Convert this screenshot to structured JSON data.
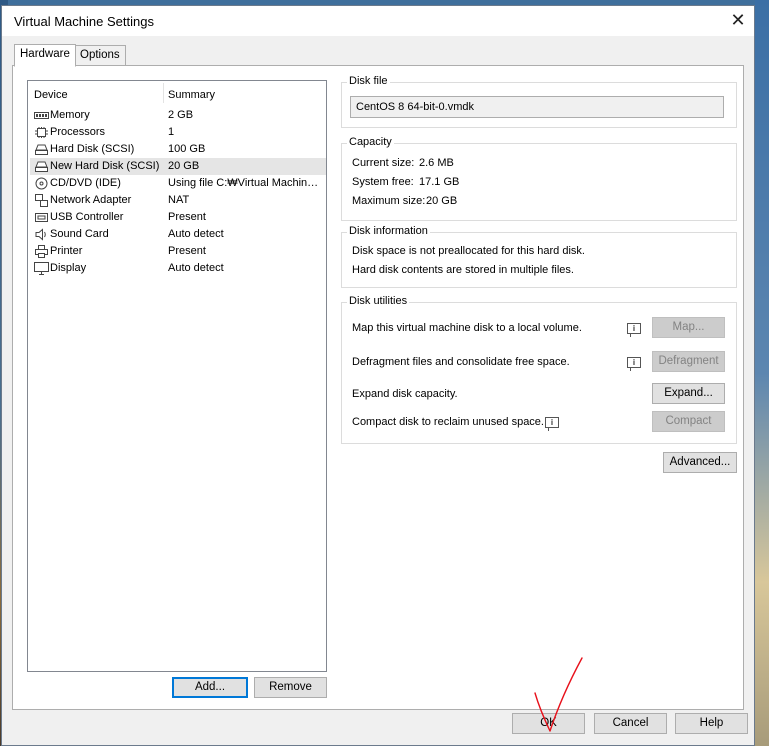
{
  "window": {
    "title": "Virtual Machine Settings"
  },
  "tabs": [
    {
      "label": "Hardware"
    },
    {
      "label": "Options"
    }
  ],
  "devices": {
    "header": {
      "device": "Device",
      "summary": "Summary"
    },
    "items": [
      {
        "name": "Memory",
        "summary": "2 GB",
        "icon": "memory-icon"
      },
      {
        "name": "Processors",
        "summary": "1",
        "icon": "processor-icon"
      },
      {
        "name": "Hard Disk (SCSI)",
        "summary": "100 GB",
        "icon": "hard-disk-icon"
      },
      {
        "name": "New Hard Disk (SCSI)",
        "summary": "20 GB",
        "icon": "hard-disk-icon",
        "selected": true
      },
      {
        "name": "CD/DVD (IDE)",
        "summary": "Using file C:₩Virtual Machin…",
        "icon": "cd-dvd-icon"
      },
      {
        "name": "Network Adapter",
        "summary": "NAT",
        "icon": "network-adapter-icon"
      },
      {
        "name": "USB Controller",
        "summary": "Present",
        "icon": "usb-icon"
      },
      {
        "name": "Sound Card",
        "summary": "Auto detect",
        "icon": "speaker-icon"
      },
      {
        "name": "Printer",
        "summary": "Present",
        "icon": "printer-icon"
      },
      {
        "name": "Display",
        "summary": "Auto detect",
        "icon": "monitor-icon"
      }
    ],
    "add_label": "Add...",
    "remove_label": "Remove"
  },
  "disk_file": {
    "title": "Disk file",
    "value": "CentOS 8 64-bit-0.vmdk"
  },
  "capacity": {
    "title": "Capacity",
    "current_label": "Current size:",
    "current_value": "2.6 MB",
    "free_label": "System free:",
    "free_value": "17.1 GB",
    "max_label": "Maximum size:",
    "max_value": "20 GB"
  },
  "disk_info": {
    "title": "Disk information",
    "line1": "Disk space is not preallocated for this hard disk.",
    "line2": "Hard disk contents are stored in multiple files."
  },
  "disk_utilities": {
    "title": "Disk utilities",
    "map_text": "Map this virtual machine disk to a local volume.",
    "map_button": "Map...",
    "defrag_text": "Defragment files and consolidate free space.",
    "defrag_button": "Defragment",
    "expand_text": "Expand disk capacity.",
    "expand_button": "Expand...",
    "compact_text": "Compact disk to reclaim unused space.",
    "compact_button": "Compact"
  },
  "advanced_label": "Advanced...",
  "footer": {
    "ok": "OK",
    "cancel": "Cancel",
    "help": "Help"
  },
  "colors": {
    "accent": "#0078d7",
    "annotation": "#e8101a",
    "selection": "#e5e5e5"
  }
}
